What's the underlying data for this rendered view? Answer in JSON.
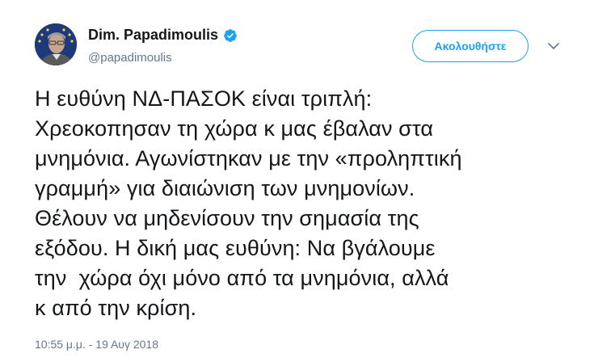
{
  "author": {
    "name": "Dim. Papadimoulis",
    "handle": "@papadimoulis",
    "verified": true
  },
  "header": {
    "follow_label": "Ακολουθήστε"
  },
  "icons": {
    "verified": "verified-badge-icon",
    "more": "chevron-down-icon"
  },
  "tweet": {
    "lines": [
      "Η ευθύνη ΝΔ-ΠΑΣΟΚ είναι τριπλή:",
      "Χρεοκοπησαν τη χώρα κ μας έβαλαν στα",
      "μνημόνια. Αγωνίστηκαν με την «προληπτική",
      "γραμμή» για διαιώνιση των μνημονίων.",
      "Θέλουν να μηδενίσουν την σημασία της",
      "εξόδου. Η δική μας ευθύνη: Να βγάλουμε",
      "την  χώρα όχι μόνο από τα μνημόνια, αλλά",
      "κ από την κρίση."
    ],
    "timestamp": "10:55 μ.μ. - 19 Αυγ 2018"
  },
  "colors": {
    "accent": "#1da1f2",
    "text": "#14171a",
    "muted": "#657786"
  }
}
